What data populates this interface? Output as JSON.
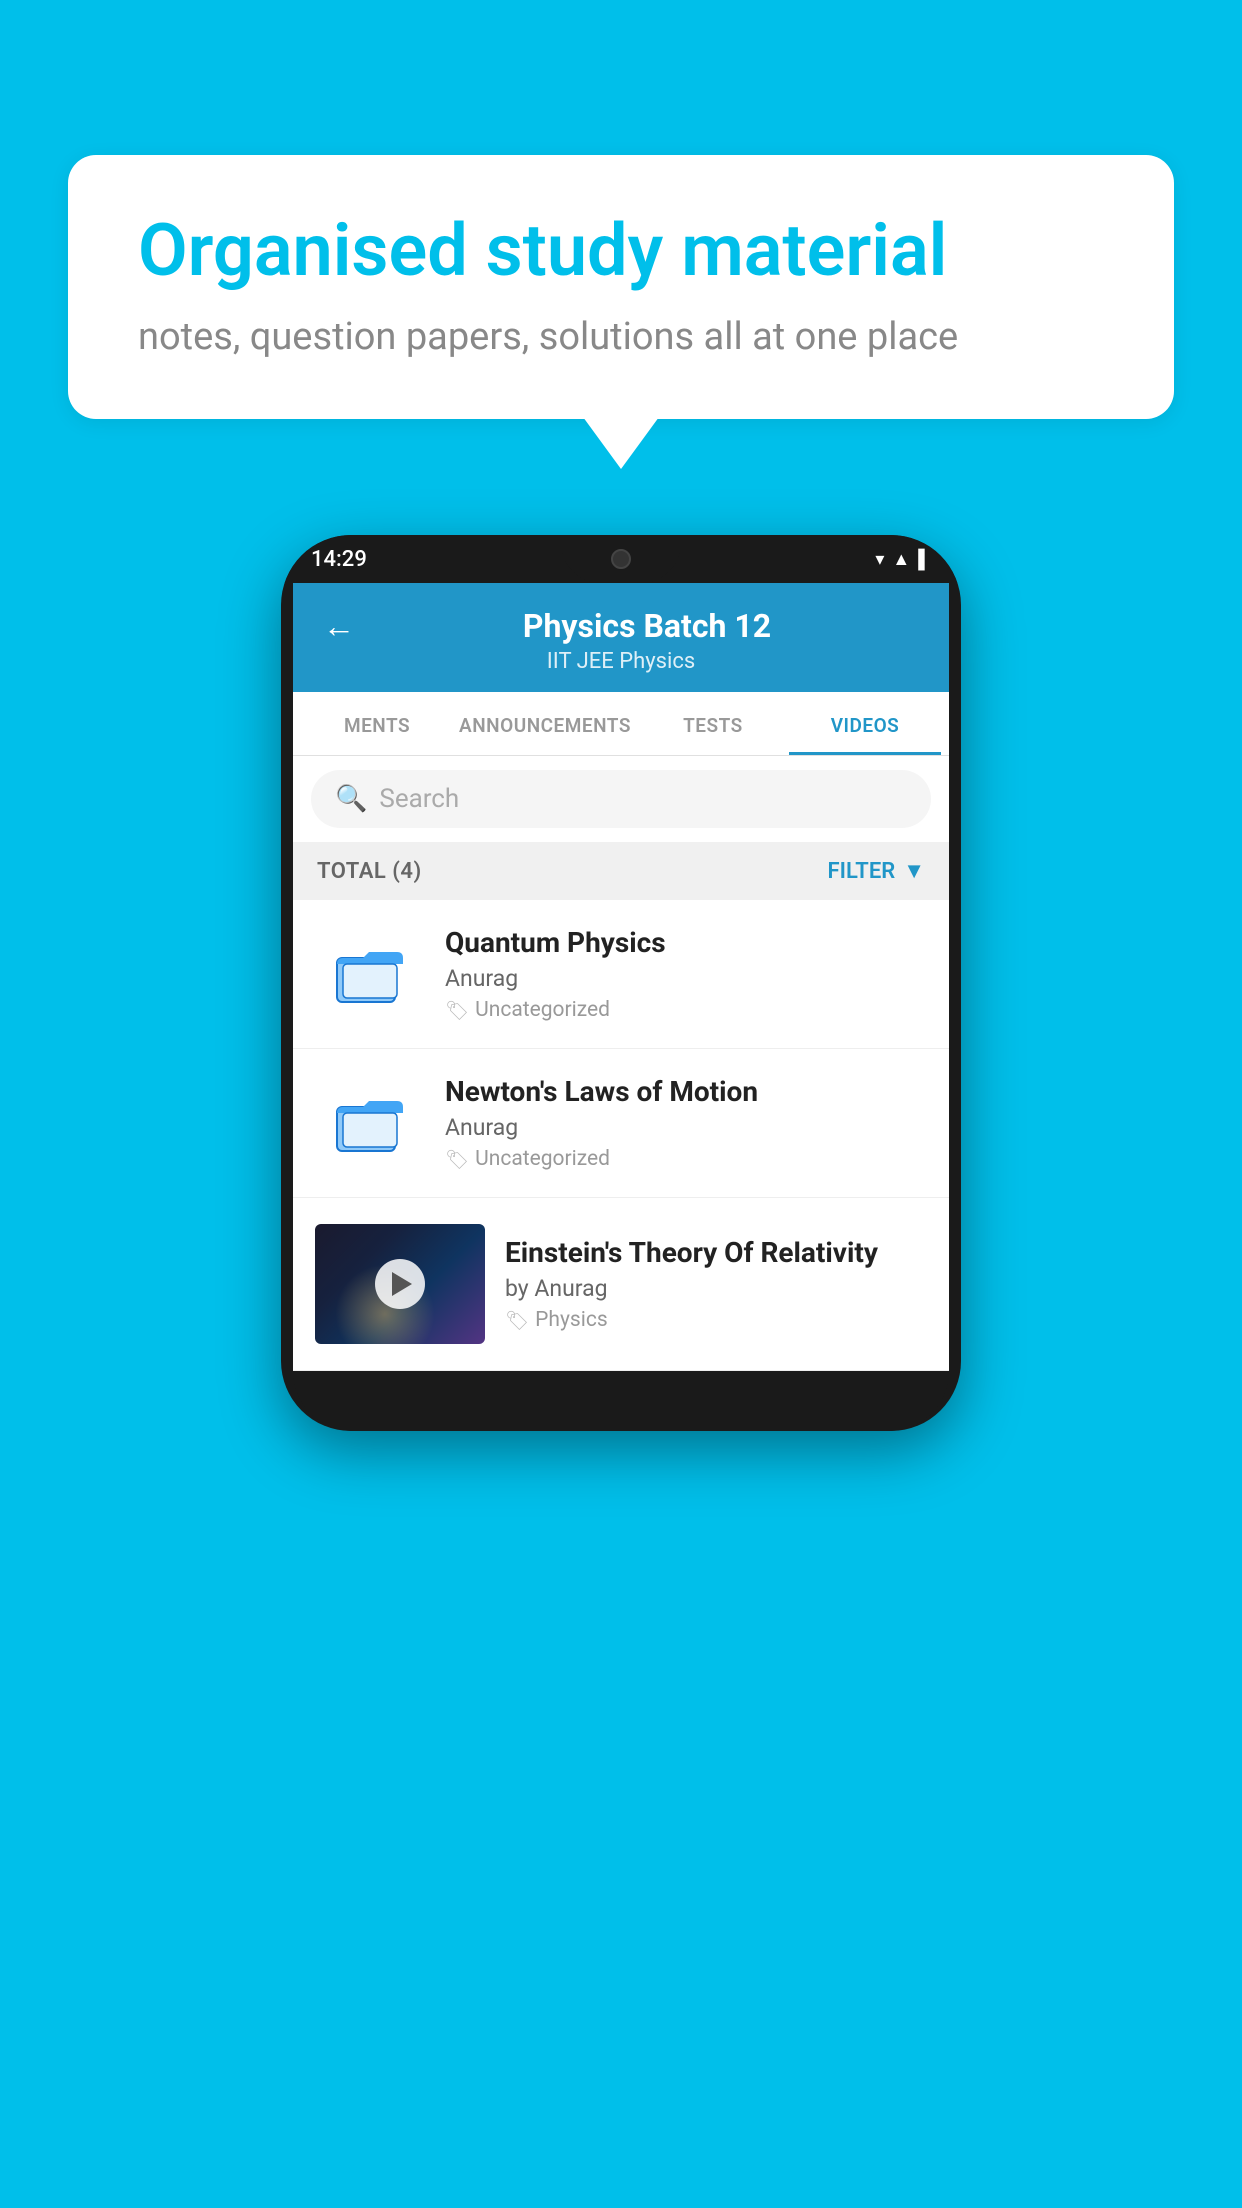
{
  "background_color": "#00BFEA",
  "speech_bubble": {
    "title": "Organised study material",
    "subtitle": "notes, question papers, solutions all at one place"
  },
  "phone": {
    "status_bar": {
      "time": "14:29"
    },
    "header": {
      "title": "Physics Batch 12",
      "subtitle": "IIT JEE   Physics",
      "back_label": "←"
    },
    "tabs": [
      {
        "label": "MENTS",
        "active": false
      },
      {
        "label": "ANNOUNCEMENTS",
        "active": false
      },
      {
        "label": "TESTS",
        "active": false
      },
      {
        "label": "VIDEOS",
        "active": true
      }
    ],
    "search": {
      "placeholder": "Search"
    },
    "filter_bar": {
      "total_label": "TOTAL (4)",
      "filter_label": "FILTER"
    },
    "video_items": [
      {
        "title": "Quantum Physics",
        "author": "Anurag",
        "tag": "Uncategorized",
        "type": "folder"
      },
      {
        "title": "Newton's Laws of Motion",
        "author": "Anurag",
        "tag": "Uncategorized",
        "type": "folder"
      },
      {
        "title": "Einstein's Theory Of Relativity",
        "author": "by Anurag",
        "tag": "Physics",
        "type": "video"
      }
    ]
  }
}
